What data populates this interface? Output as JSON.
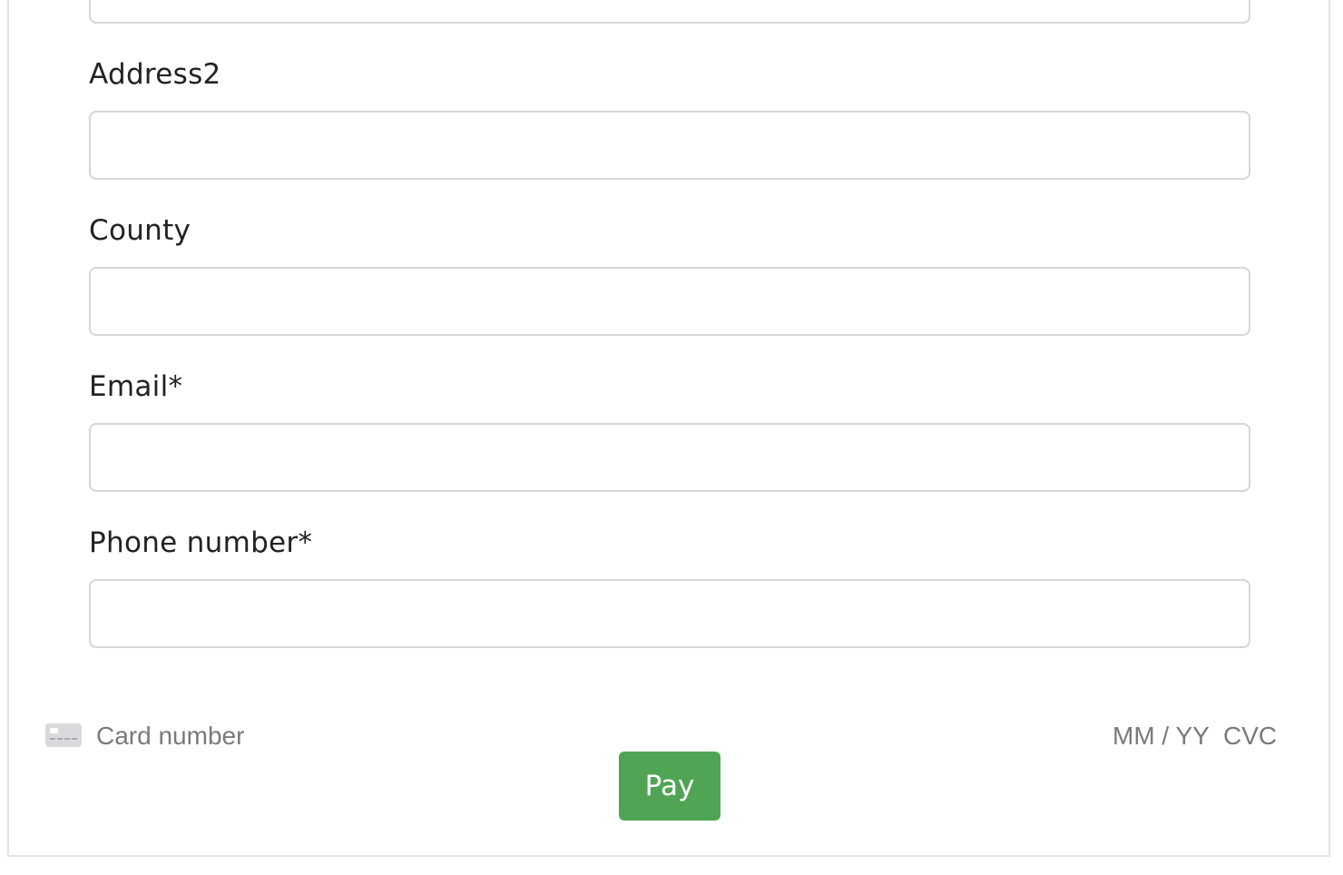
{
  "form": {
    "fields": [
      {
        "label": "Address2",
        "value": ""
      },
      {
        "label": "County",
        "value": ""
      },
      {
        "label": "Email*",
        "value": ""
      },
      {
        "label": "Phone number*",
        "value": ""
      }
    ]
  },
  "card": {
    "icon": "credit-card-icon",
    "number_placeholder": "Card number",
    "expiry_placeholder": "MM / YY",
    "cvc_placeholder": "CVC"
  },
  "actions": {
    "pay_label": "Pay",
    "pay_color": "#4fa554"
  }
}
